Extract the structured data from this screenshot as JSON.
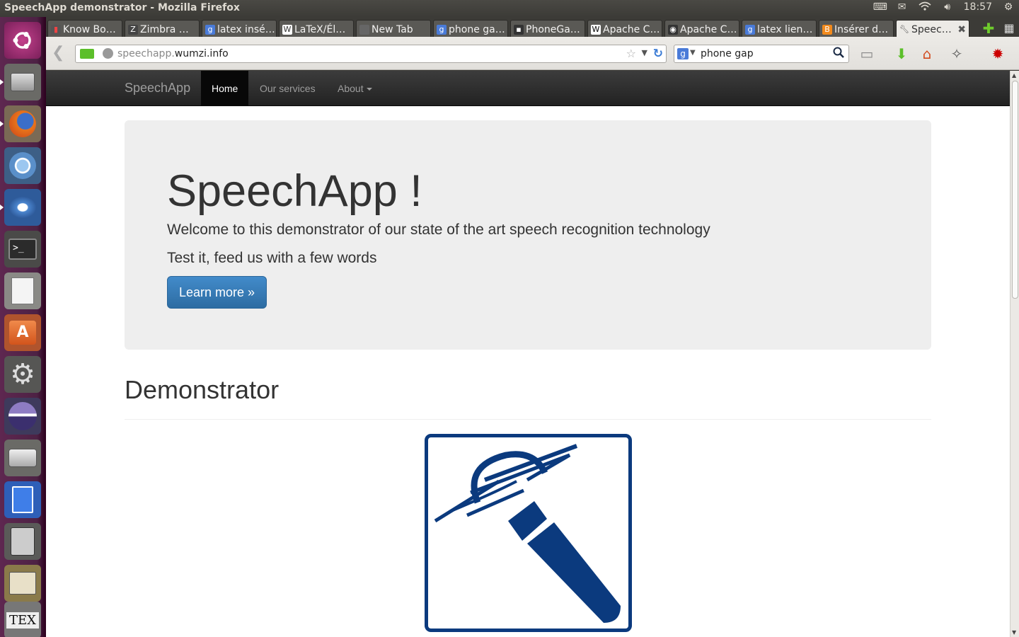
{
  "system": {
    "window_title": "SpeechApp demonstrator - Mozilla Firefox",
    "clock": "18:57"
  },
  "launcher": {
    "items": [
      "ubuntu-dash",
      "files",
      "firefox",
      "chromium",
      "thunderbird",
      "terminal",
      "text-editor",
      "software-center",
      "system-settings",
      "eclipse",
      "disk",
      "docs",
      "calculator",
      "image-viewer",
      "texmaker"
    ]
  },
  "tabs": [
    {
      "label": "Know Bo…",
      "icon": "bars-icon"
    },
    {
      "label": "Zimbra …",
      "icon": "zimbra-icon"
    },
    {
      "label": "latex insé…",
      "icon": "google-icon"
    },
    {
      "label": "LaTeX/Él…",
      "icon": "wikibooks-icon"
    },
    {
      "label": "New Tab",
      "icon": "blank-icon"
    },
    {
      "label": "phone ga…",
      "icon": "google-icon"
    },
    {
      "label": "PhoneGa…",
      "icon": "phonegap-icon"
    },
    {
      "label": "Apache C…",
      "icon": "wikipedia-icon"
    },
    {
      "label": "Apache C…",
      "icon": "cordova-icon"
    },
    {
      "label": "latex lien…",
      "icon": "google-icon"
    },
    {
      "label": "Insérer d…",
      "icon": "blog-icon"
    },
    {
      "label": "Speec…",
      "icon": "wrench-icon",
      "active": true
    }
  ],
  "toolbar": {
    "url_prefix": "speechapp.",
    "url_host": "wumzi.info",
    "search_query": "phone gap"
  },
  "site": {
    "brand": "SpeechApp",
    "nav": [
      "Home",
      "Our services",
      "About"
    ],
    "jumbotron": {
      "title": "SpeechApp !",
      "lead": "Welcome to this demonstrator of our state of the art speech recognition technology",
      "lead2": "Test it, feed us with a few words",
      "button": "Learn more »"
    },
    "section_title": "Demonstrator"
  },
  "colors": {
    "accent": "#428bca",
    "mic_blue": "#0b3a7e",
    "navbar_bg": "#222222",
    "jumbotron_bg": "#eeeeee"
  }
}
